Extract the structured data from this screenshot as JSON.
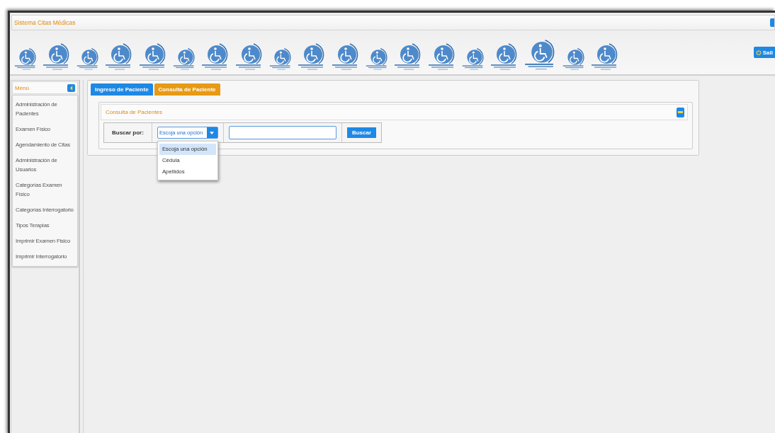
{
  "window": {
    "title": "Sistema Citas Médicas",
    "exit_button": "Sali"
  },
  "menu": {
    "title": "Menú",
    "items": [
      {
        "label": "Administración de Pacientes"
      },
      {
        "label": "Examen Físico"
      },
      {
        "label": "Agendamiento de Citas"
      },
      {
        "label": "Administración de Usuarios"
      },
      {
        "label": "Categorías Examen Físico"
      },
      {
        "label": "Categorías Interrogatorio"
      },
      {
        "label": "Tipos Terapias"
      },
      {
        "label": "Imprimir Examen Fisico"
      },
      {
        "label": "Imprimir Interrogatorio"
      }
    ]
  },
  "tabs": [
    {
      "label": "Ingreso de Paciente",
      "selected": false
    },
    {
      "label": "Consulta de Paciente",
      "selected": true
    }
  ],
  "panel": {
    "title": "Consulta de Pacientes",
    "search_label": "Buscar por:",
    "select_value": "Escoja una opción",
    "options": [
      {
        "label": "Escoja una opción",
        "selected": true
      },
      {
        "label": "Cédula",
        "selected": false
      },
      {
        "label": "Apellidos",
        "selected": false
      }
    ],
    "search_button": "Buscar"
  }
}
